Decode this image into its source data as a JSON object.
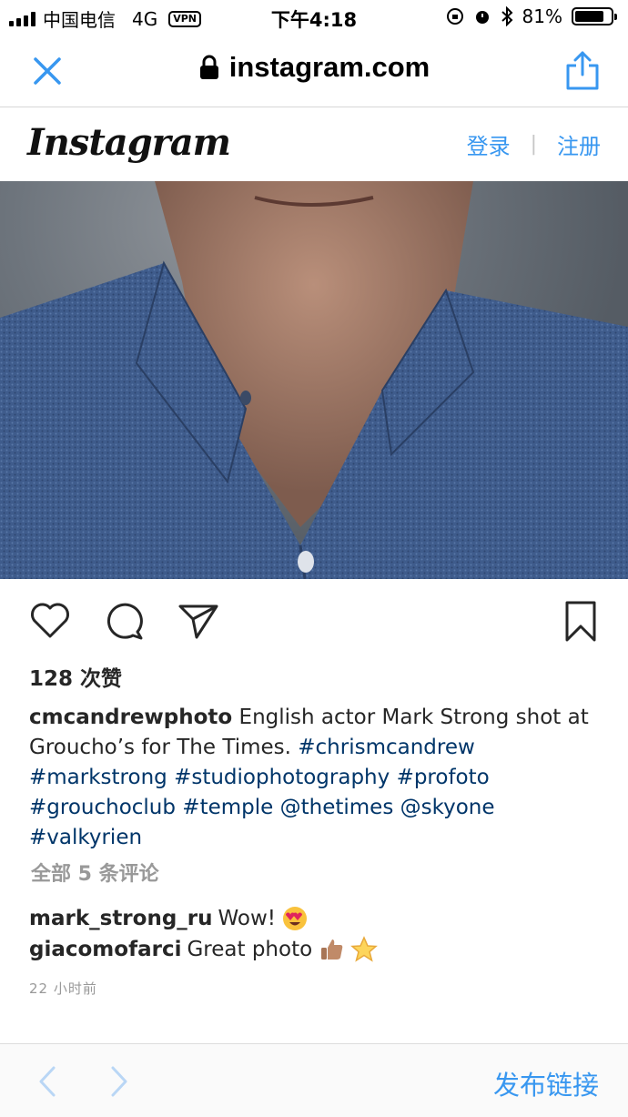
{
  "status_bar": {
    "carrier": "中国电信",
    "network": "4G",
    "vpn": "VPN",
    "time": "下午4:18",
    "battery": "81%",
    "battery_level": 0.81
  },
  "browser": {
    "url": "instagram.com"
  },
  "header": {
    "logo": "Instagram",
    "login": "登录",
    "separator": "|",
    "signup": "注册"
  },
  "post": {
    "likes": "128 次赞",
    "caption_user": "cmcandrewphoto",
    "caption_text": "English actor Mark Strong shot at Groucho’s for The Times.",
    "hashtags": [
      "#chrismcandrew",
      "#markstrong",
      "#studiophotography",
      "#profoto",
      "#grouchoclub",
      "#temple",
      "@thetimes",
      "@skyone",
      "#valkyrien"
    ],
    "view_comments": "全部 5 条评论",
    "comments": [
      {
        "user": "mark_strong_ru",
        "text": "Wow!",
        "emoji": "heart-eyes-emoji"
      },
      {
        "user": "giacomofarci",
        "text": "Great photo",
        "emoji": "thumbs-up-star-emoji"
      }
    ],
    "timestamp": "22 小时前"
  },
  "toolbar": {
    "publish": "发布链接"
  },
  "colors": {
    "link_blue": "#3897f0",
    "hashtag_blue": "#003569",
    "muted_gray": "#999999"
  }
}
